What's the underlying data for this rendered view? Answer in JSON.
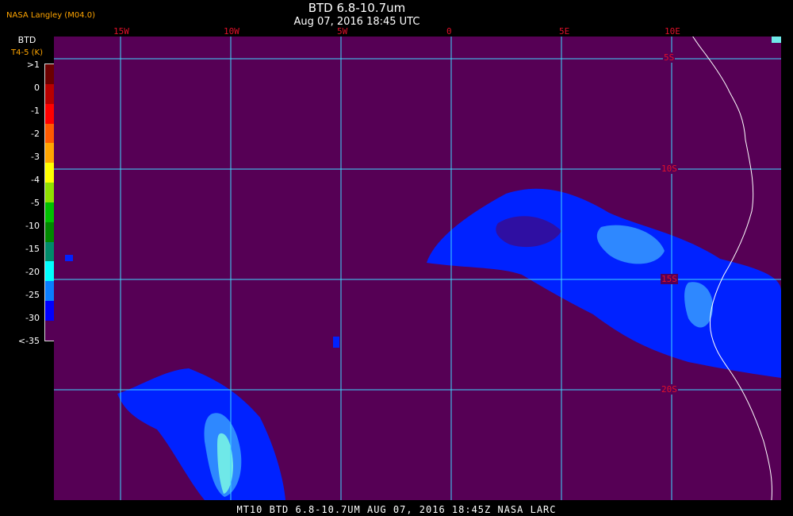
{
  "header": {
    "agency": "NASA Langley (M04.0)",
    "title": "BTD 6.8-10.7um",
    "datetime": "Aug 07, 2016 18:45 UTC"
  },
  "legend": {
    "label_top": "BTD",
    "label_units": "T4-5 (K)",
    "ticks": [
      ">1",
      "0",
      "-1",
      "-2",
      "-3",
      "-4",
      "-5",
      "-10",
      "-15",
      "-20",
      "-25",
      "-30",
      "<-35"
    ],
    "colors": [
      "#6b0000",
      "#b80000",
      "#ff0000",
      "#ff5a00",
      "#ffa500",
      "#ffff00",
      "#8fe000",
      "#00c000",
      "#008800",
      "#008a6a",
      "#00ffff",
      "#0a7eff",
      "#0000ff",
      "#560055"
    ]
  },
  "map": {
    "lon_labels": [
      "15W",
      "10W",
      "5W",
      "0",
      "5E",
      "10E"
    ],
    "lat_labels": [
      "5S",
      "10S",
      "15S",
      "20S"
    ],
    "colors": {
      "background": "#560055",
      "grid": "#3fd8ff",
      "cloud": "#0022ff",
      "cloud_mid": "#2e88ff",
      "cloud_high": "#6fe8e8",
      "coast": "#ffffff"
    }
  },
  "footer": "MT10  BTD 6.8-10.7UM   AUG 07, 2016 18:45Z   NASA LARC"
}
